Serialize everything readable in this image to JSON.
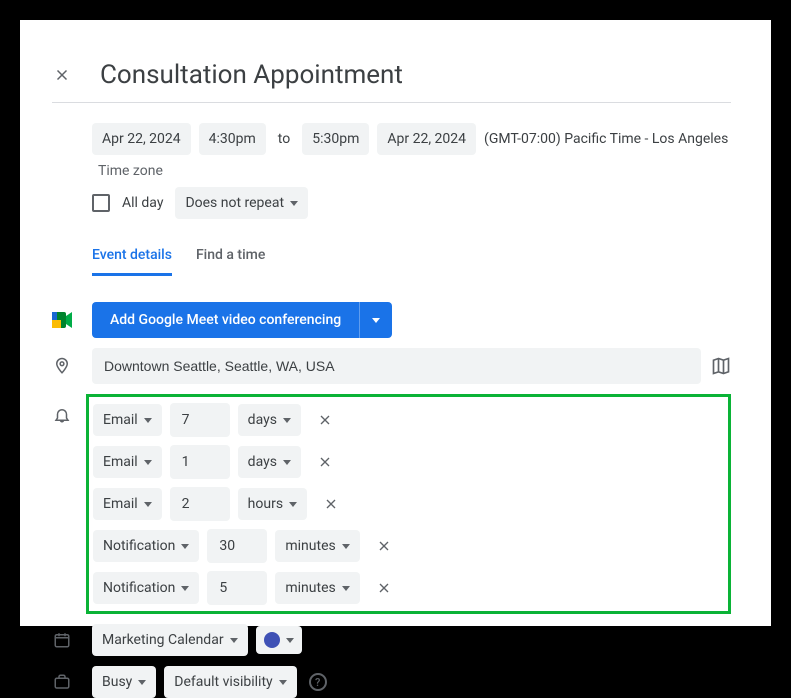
{
  "title": "Consultation Appointment",
  "datetime": {
    "start_date": "Apr 22, 2024",
    "start_time": "4:30pm",
    "to_label": "to",
    "end_time": "5:30pm",
    "end_date": "Apr 22, 2024",
    "timezone": "(GMT-07:00) Pacific Time - Los Angeles",
    "timezone_link": "Time zone"
  },
  "allday": {
    "label": "All day",
    "recurrence": "Does not repeat"
  },
  "tabs": {
    "event_details": "Event details",
    "find_a_time": "Find a time"
  },
  "meet_button": "Add Google Meet video conferencing",
  "location": "Downtown Seattle, Seattle, WA, USA",
  "notifications": [
    {
      "method": "Email",
      "amount": "7",
      "unit": "days"
    },
    {
      "method": "Email",
      "amount": "1",
      "unit": "days"
    },
    {
      "method": "Email",
      "amount": "2",
      "unit": "hours"
    },
    {
      "method": "Notification",
      "amount": "30",
      "unit": "minutes"
    },
    {
      "method": "Notification",
      "amount": "5",
      "unit": "minutes"
    }
  ],
  "calendar": {
    "name": "Marketing Calendar",
    "color": "#3f51b5"
  },
  "availability": {
    "busy": "Busy",
    "visibility": "Default visibility"
  }
}
